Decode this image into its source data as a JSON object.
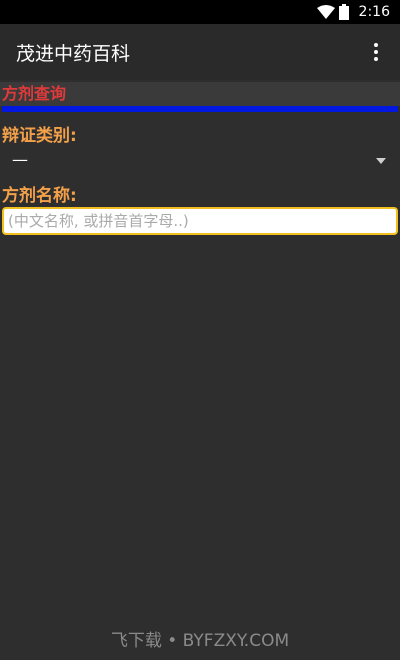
{
  "status_bar": {
    "time": "2:16",
    "icons": [
      "wifi-icon",
      "battery-icon"
    ]
  },
  "app_bar": {
    "title": "茂进中药百科",
    "menu_icon": "more-vert-icon"
  },
  "section": {
    "title": "方剂查询"
  },
  "form": {
    "category_label": "辩证类别:",
    "category_value": "—",
    "name_label": "方剂名称:",
    "name_placeholder": "(中文名称, 或拼音首字母..)"
  },
  "watermark": {
    "text": "飞下载 • BYFZXY.COM"
  },
  "colors": {
    "section_title": "#e03a3a",
    "section_line": "#0018e0",
    "label": "#f3a04a",
    "input_border": "#f0c020"
  }
}
